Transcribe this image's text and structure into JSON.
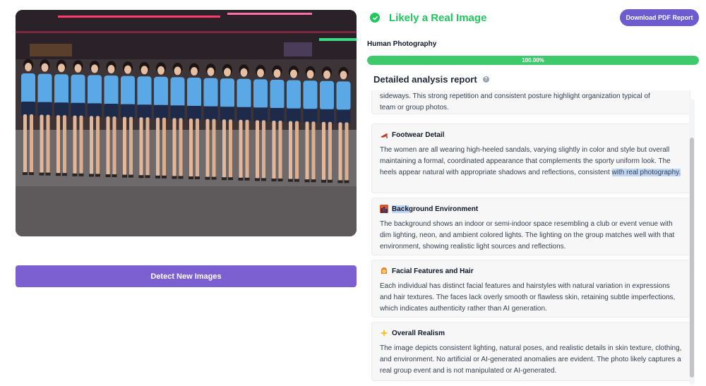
{
  "photo": {
    "alt_icon": "group-photo-image"
  },
  "detect_button": {
    "label": "Detect New Images"
  },
  "verdict": {
    "title": "Likely a Real Image",
    "icon": "check-circle-icon",
    "color": "#22c55e"
  },
  "download_button": {
    "label": "Download PDF Report"
  },
  "classification": {
    "label": "Human Photography",
    "confidence_text": "100.00%",
    "confidence": 1.0
  },
  "report": {
    "title": "Detailed analysis report",
    "help_icon": "question-icon",
    "partial_top_text_line1": "sideways. This strong repetition and consistent posture highlight organization typical of",
    "partial_top_text_line2": "team or group photos.",
    "sections": [
      {
        "icon": "high-heel-icon",
        "title": "Footwear Detail",
        "body_main": "The women are all wearing high-heeled sandals, varying slightly in color and style but overall maintaining a formal, coordinated appearance that complements the sporty uniform look. The heels appear natural with appropriate shadows and reflections, consistent ",
        "body_highlight": "with real photography."
      },
      {
        "icon": "city-skyline-icon",
        "title_highlight": "Back",
        "title_rest": "ground Environment",
        "body": "The background shows an indoor or semi-indoor space resembling a club or event venue with dim lighting, neon, and ambient colored lights. The lighting on the group matches well with that environment, showing realistic light sources and reflections."
      },
      {
        "icon": "person-face-icon",
        "title": "Facial Features and Hair",
        "body": "Each individual has distinct facial features and hairstyles with natural variation in expressions and hair textures. The faces lack overly smooth or flawless skin, retaining subtle imperfections, which indicates authenticity rather than AI generation."
      },
      {
        "icon": "sparkle-star-icon",
        "title": "Overall Realism",
        "body": "The image depicts consistent lighting, natural poses, and realistic details in skin texture, clothing, and environment. No artificial or AI-generated anomalies are evident. The photo likely captures a real group event and is not manipulated or AI-generated."
      }
    ]
  }
}
